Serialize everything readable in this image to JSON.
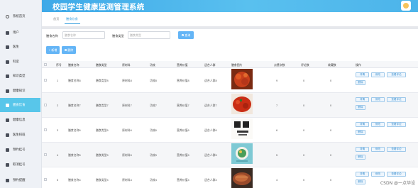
{
  "app_title": "校园学生健康监测管理系统",
  "sidebar": {
    "items": [
      {
        "label": "系统首页",
        "icon": "home-icon",
        "active": false
      },
      {
        "label": "用户",
        "icon": "user-icon",
        "active": false
      },
      {
        "label": "医生",
        "icon": "doctor-icon",
        "active": false
      },
      {
        "label": "科室",
        "icon": "department-icon",
        "active": false
      },
      {
        "label": "知识类型",
        "icon": "category-icon",
        "active": false
      },
      {
        "label": "健康知识",
        "icon": "book-icon",
        "active": false
      },
      {
        "label": "膳食饮食",
        "icon": "diet-icon",
        "active": true
      },
      {
        "label": "健康信息",
        "icon": "info-icon",
        "active": false
      },
      {
        "label": "医生排班",
        "icon": "schedule-icon",
        "active": false
      },
      {
        "label": "预约挂号",
        "icon": "appointment-icon",
        "active": false
      },
      {
        "label": "取消挂号",
        "icon": "cancel-icon",
        "active": false
      },
      {
        "label": "预约提醒",
        "icon": "bell-icon",
        "active": false
      }
    ]
  },
  "breadcrumb": {
    "home": "首页",
    "current": "膳食饮食"
  },
  "search": {
    "name_label": "膳食名称",
    "name_placeholder": "膳食名称",
    "type_label": "膳食类型",
    "type_placeholder": "膳食类型",
    "search_button": "查询"
  },
  "toolbar": {
    "add_button": "新增",
    "delete_button": "删除"
  },
  "table": {
    "headers": [
      "序号",
      "膳食名称",
      "膳食类型",
      "原材料",
      "功效",
      "营养价值",
      "适合人群",
      "膳食图片",
      "点赞次数",
      "评论数",
      "收藏数",
      "操作"
    ],
    "rows": [
      {
        "index": "1",
        "name": "膳食名称8",
        "type": "膳食类型8",
        "material": "原材料8",
        "effect": "功效8",
        "nutrition": "营养价值8",
        "suitable": "适合人群8",
        "likes": "9",
        "comments": "0",
        "favorites": "0"
      },
      {
        "index": "2",
        "name": "膳食名称7",
        "type": "膳食类型7",
        "material": "原材料7",
        "effect": "功效7",
        "nutrition": "营养价值7",
        "suitable": "适合人群7",
        "likes": "7",
        "comments": "0",
        "favorites": "0"
      },
      {
        "index": "3",
        "name": "膳食名称6",
        "type": "膳食类型6",
        "material": "原材料6",
        "effect": "功效6",
        "nutrition": "营养价值6",
        "suitable": "适合人群6",
        "likes": "6",
        "comments": "0",
        "favorites": "0"
      },
      {
        "index": "4",
        "name": "膳食名称5",
        "type": "膳食类型5",
        "material": "原材料5",
        "effect": "功效5",
        "nutrition": "营养价值5",
        "suitable": "适合人群5",
        "likes": "5",
        "comments": "0",
        "favorites": "0"
      },
      {
        "index": "5",
        "name": "膳食名称4",
        "type": "膳食类型4",
        "material": "原材料4",
        "effect": "功效4",
        "nutrition": "营养价值4",
        "suitable": "适合人群4",
        "likes": "4",
        "comments": "0",
        "favorites": "0"
      }
    ],
    "actions": {
      "detail": "详情",
      "edit": "修改",
      "review": "查看评论",
      "delete": "删除"
    }
  },
  "watermark": "CSDN @一点毕设",
  "colors": {
    "accent": "#58c6ea",
    "header": "#4cb4ea",
    "button": "#64b5f6"
  }
}
